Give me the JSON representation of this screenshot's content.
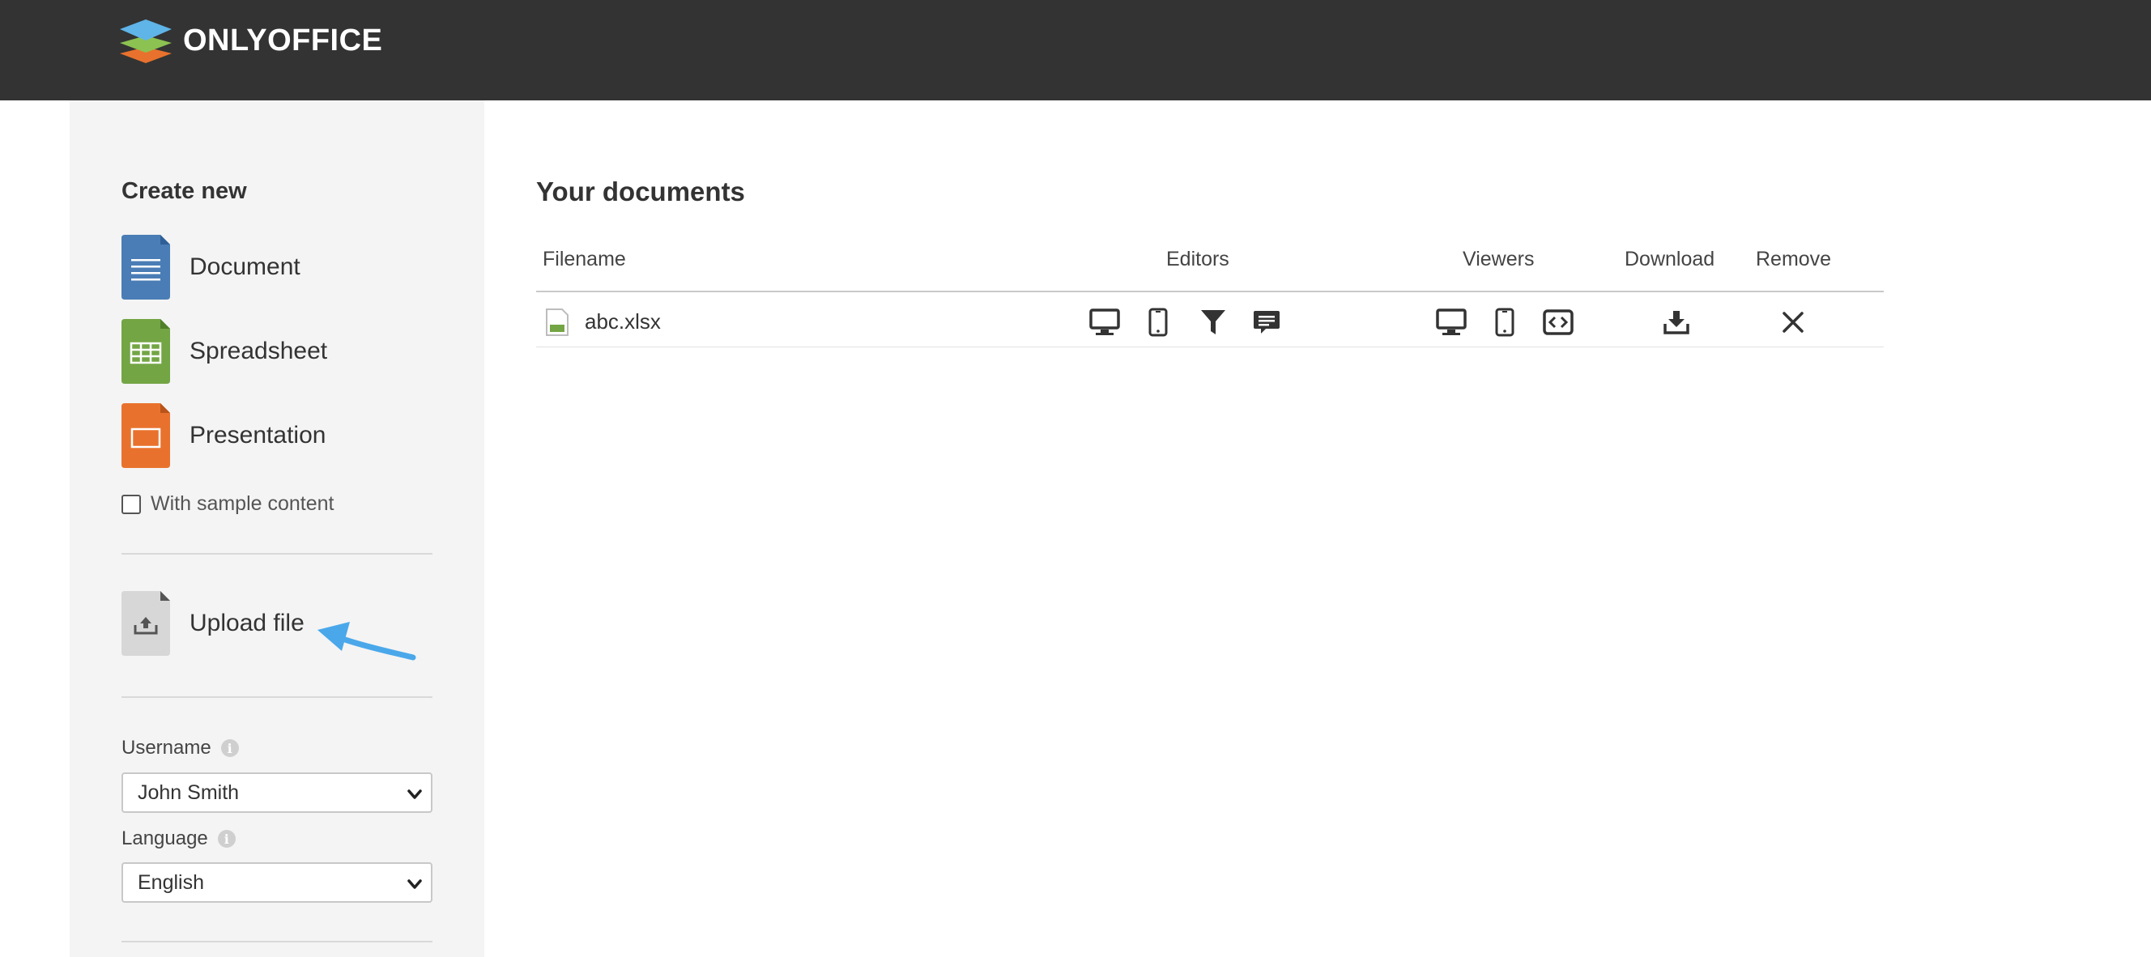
{
  "header": {
    "brand": "ONLYOFFICE"
  },
  "sidebar": {
    "create_title": "Create new",
    "create_items": [
      {
        "label": "Document",
        "icon": "document-icon",
        "color": "#4a7db5"
      },
      {
        "label": "Spreadsheet",
        "icon": "spreadsheet-icon",
        "color": "#73a544"
      },
      {
        "label": "Presentation",
        "icon": "presentation-icon",
        "color": "#e8722d"
      }
    ],
    "sample_content_label": "With sample content",
    "sample_content_checked": false,
    "upload_label": "Upload file",
    "username_label": "Username",
    "username_value": "John Smith",
    "language_label": "Language",
    "language_value": "English"
  },
  "main": {
    "title": "Your documents",
    "columns": {
      "filename": "Filename",
      "editors": "Editors",
      "viewers": "Viewers",
      "download": "Download",
      "remove": "Remove"
    },
    "files": [
      {
        "name": "abc.xlsx",
        "editor_actions": [
          "desktop-icon",
          "mobile-icon",
          "filter-icon",
          "comment-icon"
        ],
        "viewer_actions": [
          "desktop-icon",
          "mobile-icon",
          "embed-icon"
        ],
        "download_icon": "download-icon",
        "remove_icon": "close-icon"
      }
    ]
  },
  "colors": {
    "header_bg": "#333333",
    "sidebar_bg": "#f4f4f4",
    "annotation_arrow": "#4aa8ea"
  }
}
